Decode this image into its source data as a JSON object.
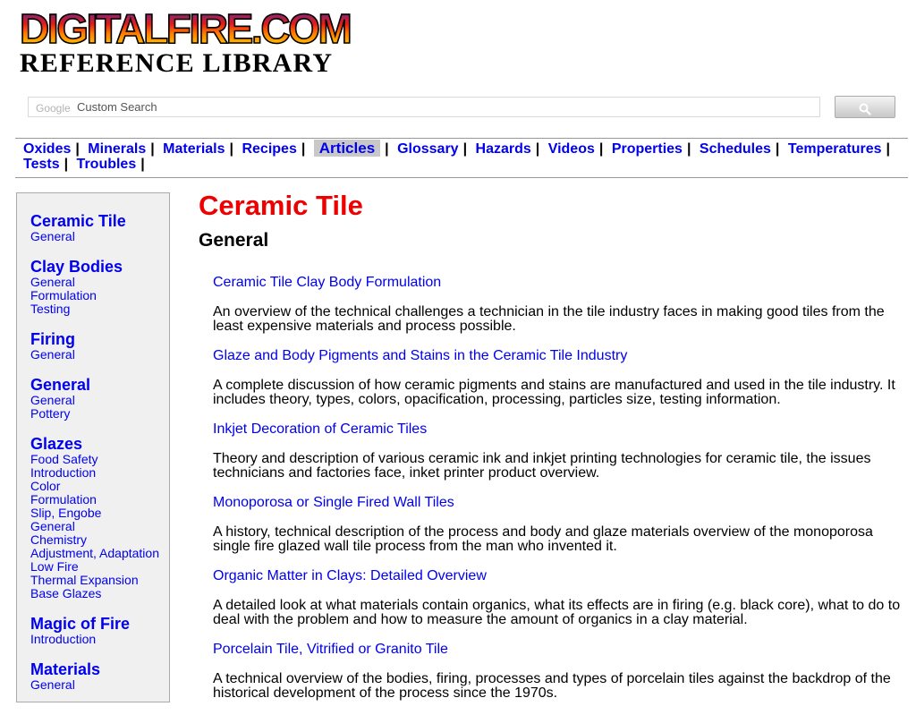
{
  "header": {
    "logo_top": "DIGITALFIRE.COM",
    "logo_bottom": "REFERENCE LIBRARY"
  },
  "search": {
    "provider_logo": "Google",
    "placeholder": "Custom Search",
    "button_icon": "search-icon"
  },
  "nav": {
    "separator": "|",
    "items": [
      {
        "label": "Oxides",
        "active": false
      },
      {
        "label": "Minerals",
        "active": false
      },
      {
        "label": "Materials",
        "active": false
      },
      {
        "label": "Recipes",
        "active": false
      },
      {
        "label": "Articles",
        "active": true
      },
      {
        "label": "Glossary",
        "active": false
      },
      {
        "label": "Hazards",
        "active": false
      },
      {
        "label": "Videos",
        "active": false
      },
      {
        "label": "Properties",
        "active": false
      },
      {
        "label": "Schedules",
        "active": false
      },
      {
        "label": "Temperatures",
        "active": false
      },
      {
        "label": "Tests",
        "active": false
      },
      {
        "label": "Troubles",
        "active": false
      }
    ]
  },
  "sidebar": {
    "groups": [
      {
        "title": "Ceramic Tile",
        "links": [
          "General"
        ]
      },
      {
        "title": "Clay Bodies",
        "links": [
          "General",
          "Formulation",
          "Testing"
        ]
      },
      {
        "title": "Firing",
        "links": [
          "General"
        ]
      },
      {
        "title": "General",
        "links": [
          "General",
          "Pottery"
        ]
      },
      {
        "title": "Glazes",
        "links": [
          "Food Safety",
          "Introduction",
          "Color",
          "Formulation",
          "Slip, Engobe",
          "General",
          "Chemistry",
          "Adjustment, Adaptation",
          "Low Fire",
          "Thermal Expansion",
          "Base Glazes"
        ]
      },
      {
        "title": "Magic of Fire",
        "links": [
          "Introduction"
        ]
      },
      {
        "title": "Materials",
        "links": [
          "General"
        ]
      }
    ]
  },
  "main": {
    "title": "Ceramic Tile",
    "section": "General",
    "articles": [
      {
        "title": "Ceramic Tile Clay Body Formulation",
        "description": "An overview of the technical challenges a technician in the tile industry faces in making good tiles from the least expensive materials and process possible."
      },
      {
        "title": "Glaze and Body Pigments and Stains in the Ceramic Tile Industry",
        "description": "A complete discussion of how ceramic pigments and stains are manufactured and used in the tile industry. It includes theory, types, colors, opacification, processing, particles size, testing information."
      },
      {
        "title": "Inkjet Decoration of Ceramic Tiles",
        "description": "Theory and description of various ceramic ink and inkjet printing technologies for ceramic tile, the issues technicians and factories face, inket printer product overview."
      },
      {
        "title": "Monoporosa or Single Fired Wall Tiles",
        "description": "A history, technical description of the process and body and glaze materials overview of the monoporosa single fire glazed wall tile process from the man who invented it."
      },
      {
        "title": "Organic Matter in Clays: Detailed Overview",
        "description": "A detailed look at what materials contain organics, what its effects are in firing (e.g. black core), what to do to deal with the problem and how to measure the amount of organics in a clay material."
      },
      {
        "title": "Porcelain Tile, Vitrified or Granito Tile",
        "description": "A technical overview of the bodies, firing, processes and types of porcelain tiles against the backdrop of the historical development of the process since the 1970s."
      }
    ]
  },
  "colors": {
    "link": "#0000ee",
    "title_red": "#ee0000",
    "sidebar_bg": "#f0f0f0",
    "active_nav_bg": "#c8c8c8"
  }
}
